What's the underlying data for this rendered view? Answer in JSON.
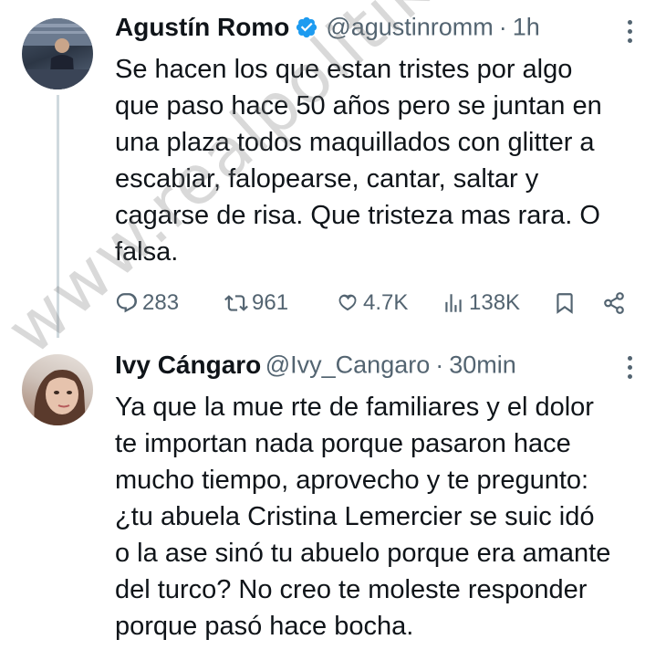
{
  "tweets": [
    {
      "name": "Agustín Romo",
      "handle": "@agustinromm",
      "separator": "·",
      "time": "1h",
      "verified": true,
      "text": "Se hacen los que estan tristes por algo\nque paso hace 50 años pero se juntan en\nuna plaza todos maquillados con glitter a\nescabiar, falopearse, cantar, saltar y\ncagarse de risa. Que tristeza mas rara. O\nfalsa.",
      "stats": {
        "replies": "283",
        "retweets": "961",
        "likes": "4.7K",
        "views": "138K"
      }
    },
    {
      "name": "Ivy Cángaro",
      "handle": "@Ivy_Cangaro",
      "separator": "·",
      "time": "30min",
      "verified": false,
      "text": "Ya que la mue rte de familiares y el dolor\nte importan nada porque pasaron hace\nmucho tiempo, aprovecho y te pregunto:\n¿tu abuela Cristina Lemercier se suic idó\no la ase sinó tu abuelo porque era amante\ndel turco? No creo te moleste responder\nporque pasó hace bocha."
    }
  ],
  "watermark": "www.realpolitik.com.ar",
  "colors": {
    "text": "#0f1419",
    "muted": "#536471",
    "verified": "#1d9bf0",
    "thread_line": "#cfd9de"
  },
  "icons": [
    "verified-badge-icon",
    "reply-icon",
    "retweet-icon",
    "like-icon",
    "views-icon",
    "bookmark-icon",
    "share-icon",
    "more-options-icon"
  ]
}
